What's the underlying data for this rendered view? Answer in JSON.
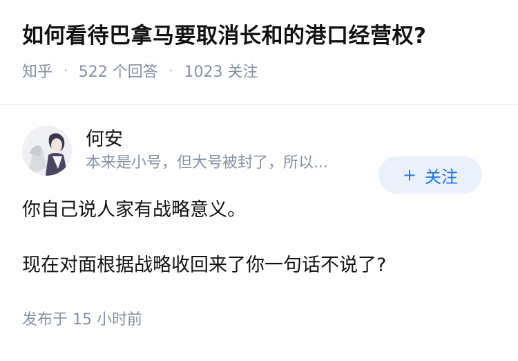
{
  "question": {
    "title": "如何看待巴拿马要取消长和的港口经营权?",
    "source": "知乎",
    "answer_count": "522 个回答",
    "follower_count": "1023 关注",
    "separator": "·"
  },
  "answer": {
    "author_name": "何安",
    "author_bio": "本来是小号，但大号被封了，所以...",
    "follow_label": "关注",
    "follow_icon": "+",
    "paragraphs": [
      "你自己说人家有战略意义。",
      "现在对面根据战略收回来了你一句话不说了?"
    ],
    "published": "发布于 15 小时前"
  },
  "colors": {
    "accent": "#1772f6",
    "button_bg": "#ebf1fb",
    "muted_text": "#8590a6"
  }
}
